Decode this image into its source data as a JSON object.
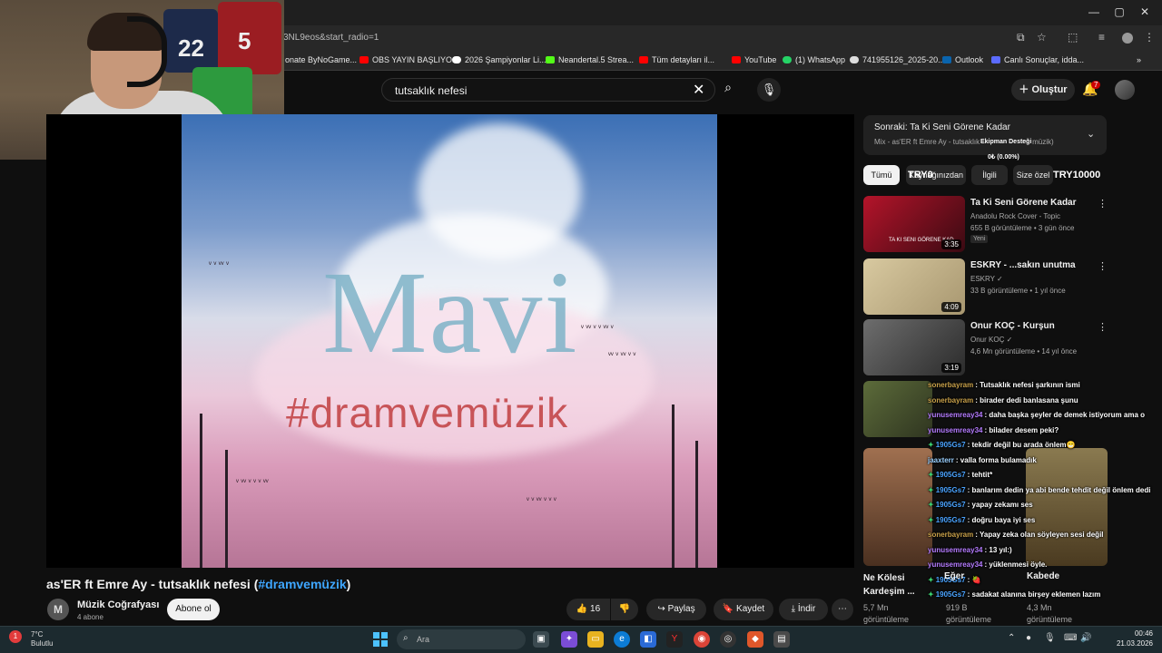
{
  "browser": {
    "url": "3NL9eos&start_radio=1",
    "bookmarks": [
      {
        "label": "onate ByNoGame...",
        "color": "#888888"
      },
      {
        "label": "OBS YAYIN BAŞLIYO...",
        "color": "#ff0000"
      },
      {
        "label": "2026 Şampiyonlar Li...",
        "color": "#ffffff"
      },
      {
        "label": "Neandertal.5 Strea...",
        "color": "#53fc18"
      },
      {
        "label": "Tüm detayları il...",
        "color": "#ff0000"
      },
      {
        "label": "YouTube",
        "color": "#ff0000"
      },
      {
        "label": "(1) WhatsApp",
        "color": "#25d366"
      },
      {
        "label": "741955126_2025-20...",
        "color": "#dddddd"
      },
      {
        "label": "Outlook",
        "color": "#0a64ad"
      },
      {
        "label": "Canlı Sonuçlar, idda...",
        "color": "#5b6bff"
      }
    ]
  },
  "header": {
    "search_query": "tutsaklık nefesi",
    "create_label": "Oluştur",
    "notification_count": "7"
  },
  "video": {
    "overlay_text_1": "Mavi",
    "overlay_text_2": "#dramvemüzik",
    "title_main": "as'ER ft Emre Ay - tutsaklık nefesi (",
    "title_tag": "#dramvemüzik",
    "title_end": ")",
    "channel_initial": "M",
    "channel_name": "Müzik Coğrafyası",
    "subscribers": "4 abone",
    "subscribe_label": "Abone ol",
    "likes": "16",
    "share_label": "Paylaş",
    "save_label": "Kaydet",
    "download_label": "İndir",
    "more_label": "⋯"
  },
  "sidebar": {
    "up_next_title": "Sonraki: Ta Ki Seni Görene Kadar",
    "up_next_sub": "Mix - as'ER ft Emre Ay - tutsaklık",
    "up_next_sub_end": "müzik)",
    "donation_label": "Ekipman Desteği",
    "donation_value": "0₺ (0.00%)",
    "chips": [
      "Tümü",
      "Kaynağınızdan",
      "İlgili",
      "Size özel"
    ],
    "try_left": "TRY0",
    "try_right": "TRY10000",
    "recommendations": [
      {
        "title": "Ta Ki Seni Görene Kadar",
        "channel": "Anadolu Rock Cover - Topic",
        "meta": "655 B görüntüleme • 3 gün önce",
        "badge": "Yeni",
        "duration": "3:35",
        "thumb_caption": "TA KI SENI GÖRENE KAD"
      },
      {
        "title": "ESKRY - ...sakın unutma",
        "channel": "ESKRY ✓",
        "meta": "33 B görüntüleme • 1 yıl önce",
        "badge": "",
        "duration": "4:09"
      },
      {
        "title": "Onur KOÇ - Kurşun",
        "channel": "Onur KOÇ ✓",
        "meta": "4,6 Mn görüntüleme • 14 yıl önce",
        "badge": "",
        "duration": "3:19"
      }
    ],
    "bottom_cards": [
      {
        "title": "Ne Kölesi Kardeşim ...",
        "meta1": "5,7 Mn",
        "meta2": "görüntüleme"
      },
      {
        "title": "Eğer",
        "meta1": "919 B",
        "meta2": "görüntüleme"
      },
      {
        "title": "Kabede",
        "meta1": "4,3 Mn",
        "meta2": "görüntüleme"
      }
    ]
  },
  "chat": [
    {
      "user": "sonerbayram",
      "msg": ": Tutsaklık nefesi şarkının ismi",
      "color": "#c9a14a",
      "star": false
    },
    {
      "user": "sonerbayram",
      "msg": ": birader dedi banlasana şunu",
      "color": "#c9a14a",
      "star": false
    },
    {
      "user": "yunusemreay34",
      "msg": ": daha başka şeyler de demek istiyorum ama o",
      "color": "#b57cff",
      "star": false
    },
    {
      "user": "yunusemreay34",
      "msg": ": bilader desem peki?",
      "color": "#b57cff",
      "star": false
    },
    {
      "user": "1905Gs7",
      "msg": ": tekdir değil bu arada önlem😁",
      "color": "#4aa3ff",
      "star": true
    },
    {
      "user": "jaaxterr",
      "msg": ": valla forma bulamadık",
      "color": "#9ad0ff",
      "star": false
    },
    {
      "user": "1905Gs7",
      "msg": ": tehtit*",
      "color": "#4aa3ff",
      "star": true
    },
    {
      "user": "1905Gs7",
      "msg": ": banlarım dedin ya abi bende tehdit değil önlem dedi",
      "color": "#4aa3ff",
      "star": true
    },
    {
      "user": "1905Gs7",
      "msg": ": yapay zekamı ses",
      "color": "#4aa3ff",
      "star": true
    },
    {
      "user": "1905Gs7",
      "msg": ": doğru baya iyi ses",
      "color": "#4aa3ff",
      "star": true
    },
    {
      "user": "sonerbayram",
      "msg": ": Yapay zeka olan söyleyen sesi değil",
      "color": "#c9a14a",
      "star": false
    },
    {
      "user": "yunusemreay34",
      "msg": ": 13 yıl:)",
      "color": "#b57cff",
      "star": false
    },
    {
      "user": "yunusemreay34",
      "msg": ": yüklenmesi öyle.",
      "color": "#b57cff",
      "star": false
    },
    {
      "user": "1905Gs7",
      "msg": ": 🍓",
      "color": "#4aa3ff",
      "star": true
    },
    {
      "user": "1905Gs7",
      "msg": ": sadakat alanına birşey eklemen lazım",
      "color": "#4aa3ff",
      "star": true
    }
  ],
  "taskbar": {
    "weather_temp": "7°C",
    "weather_desc": "Bulutlu",
    "weather_badge": "1",
    "search_placeholder": "Ara",
    "time": "00:46",
    "date": "21.03.2026"
  }
}
